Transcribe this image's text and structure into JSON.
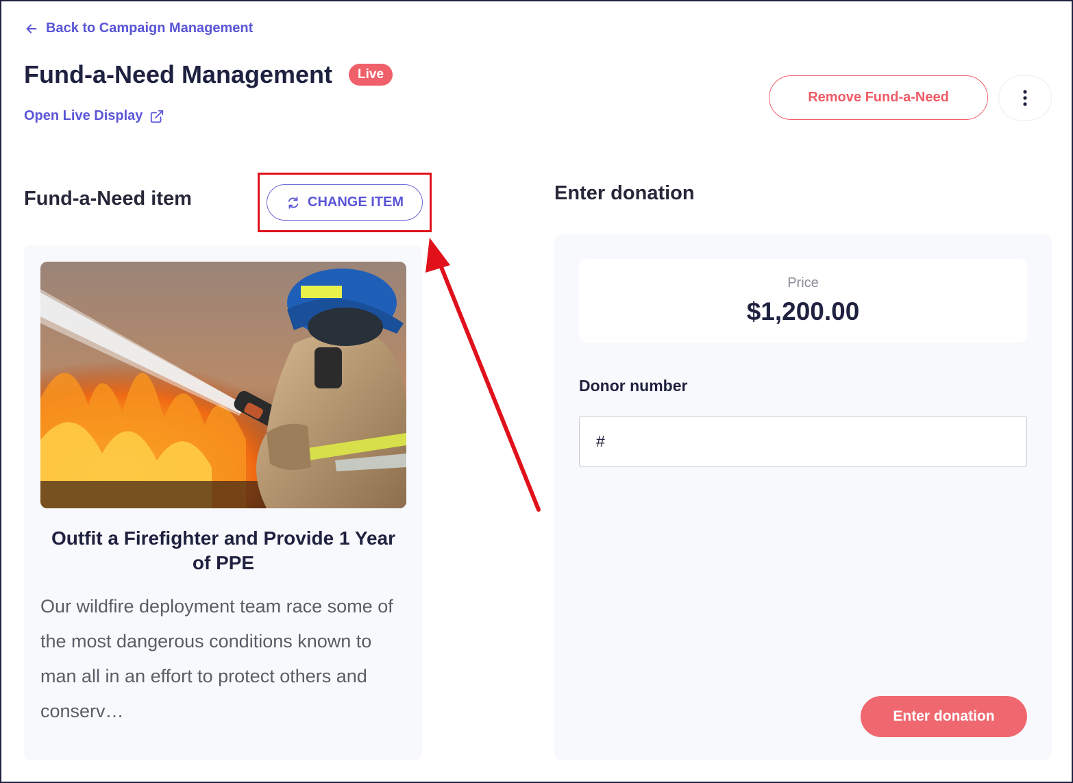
{
  "nav": {
    "back_label": "Back to Campaign Management"
  },
  "header": {
    "title": "Fund-a-Need Management",
    "status_badge": "Live",
    "open_live_label": "Open Live Display",
    "remove_label": "Remove Fund-a-Need"
  },
  "item_section": {
    "title": "Fund-a-Need item",
    "change_label": "CHANGE ITEM",
    "item": {
      "title": "Outfit a Firefighter and Provide 1 Year of PPE",
      "description": "Our wildfire deployment team race some of the most dangerous conditions known to man all in an effort to protect others and conserv…"
    }
  },
  "donation_section": {
    "title": "Enter donation",
    "price_label": "Price",
    "price_value": "$1,200.00",
    "donor_label": "Donor number",
    "donor_placeholder": "#",
    "submit_label": "Enter donation"
  },
  "colors": {
    "accent": "#5a55d6",
    "danger": "#f0606a",
    "annotation": "#e0111b"
  },
  "icons": [
    "arrow-left-icon",
    "external-link-icon",
    "more-vertical-icon",
    "refresh-icon"
  ]
}
